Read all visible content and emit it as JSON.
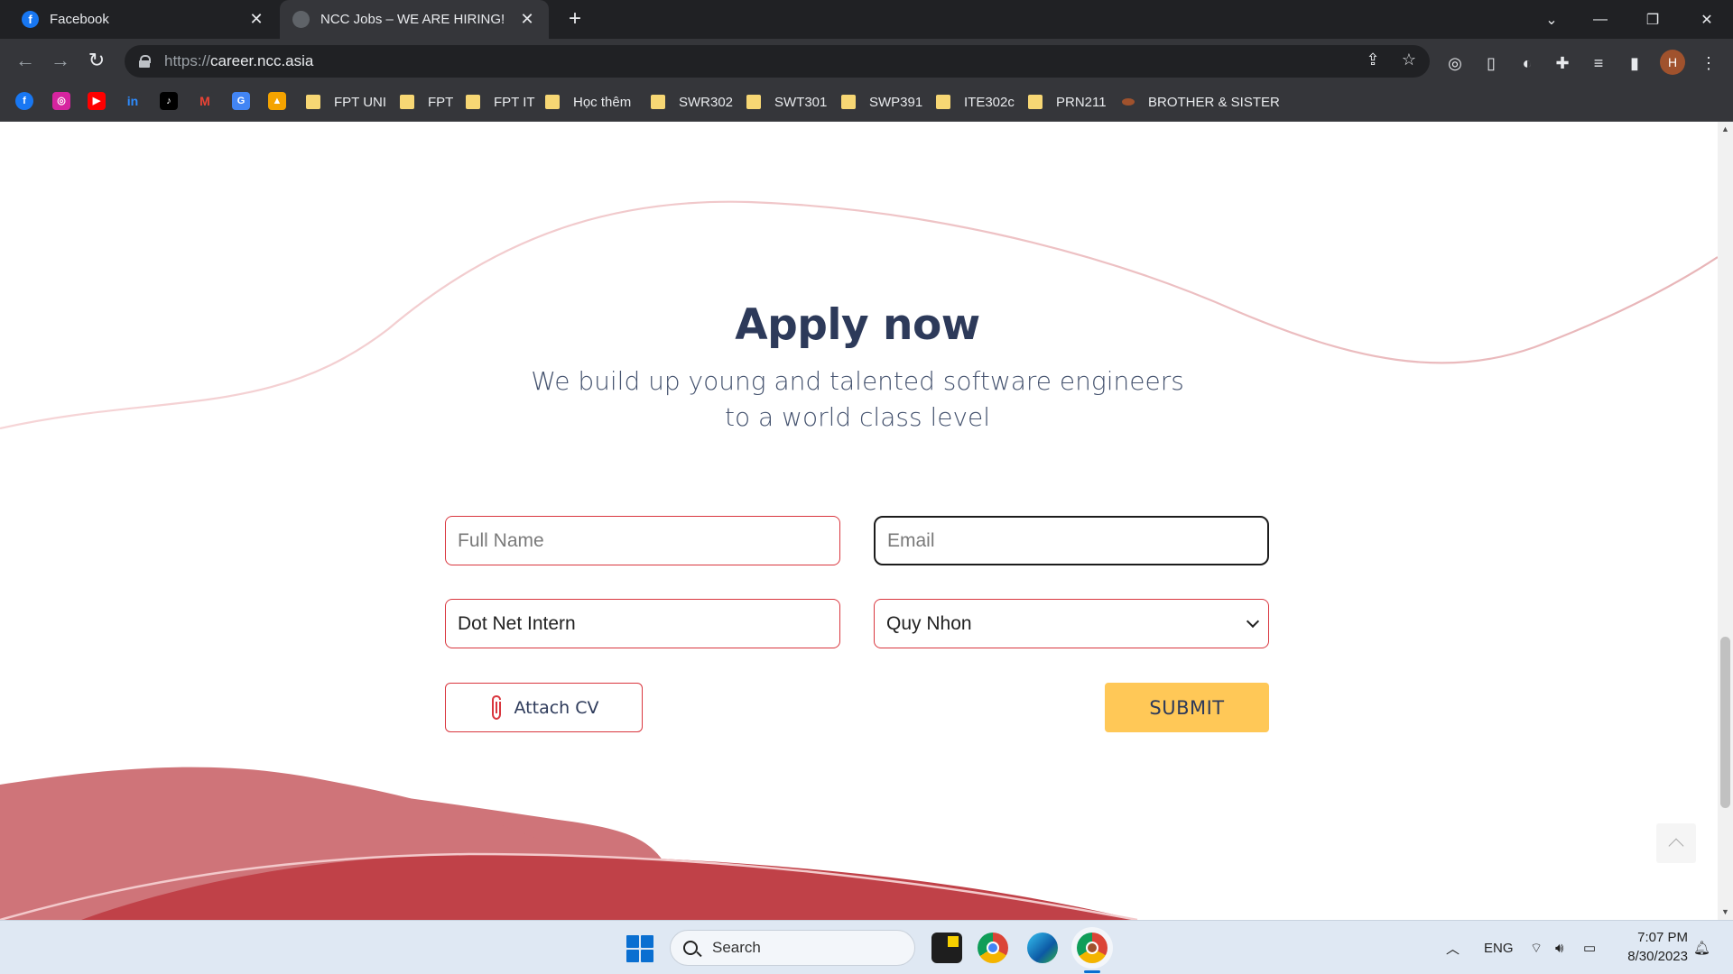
{
  "browser": {
    "tabs": [
      {
        "title": "Facebook",
        "active": false
      },
      {
        "title": "NCC Jobs – WE ARE HIRING!",
        "active": true
      }
    ],
    "url_scheme": "https://",
    "url_host": "career.ncc.asia",
    "bookmarks_folders": [
      "FPT UNI",
      "FPT",
      "FPT IT",
      "Học thêm",
      "SWR302",
      "SWT301",
      "SWP391",
      "ITE302c",
      "PRN211",
      "BROTHER & SISTER"
    ],
    "profile_initial": "H"
  },
  "page": {
    "heading": "Apply now",
    "subtitle_line1": "We build up young and talented software engineers",
    "subtitle_line2": "to a world class level",
    "form": {
      "full_name_placeholder": "Full Name",
      "email_placeholder": "Email",
      "position_value": "Dot Net Intern",
      "location_value": "Quy Nhon",
      "attach_label": "Attach CV",
      "submit_label": "SUBMIT"
    },
    "colors": {
      "accent_red": "#d9363e",
      "submit_yellow": "#ffc857",
      "heading_navy": "#2d3a5a"
    }
  },
  "taskbar": {
    "search_label": "Search",
    "language": "ENG",
    "time": "7:07 PM",
    "date": "8/30/2023"
  }
}
